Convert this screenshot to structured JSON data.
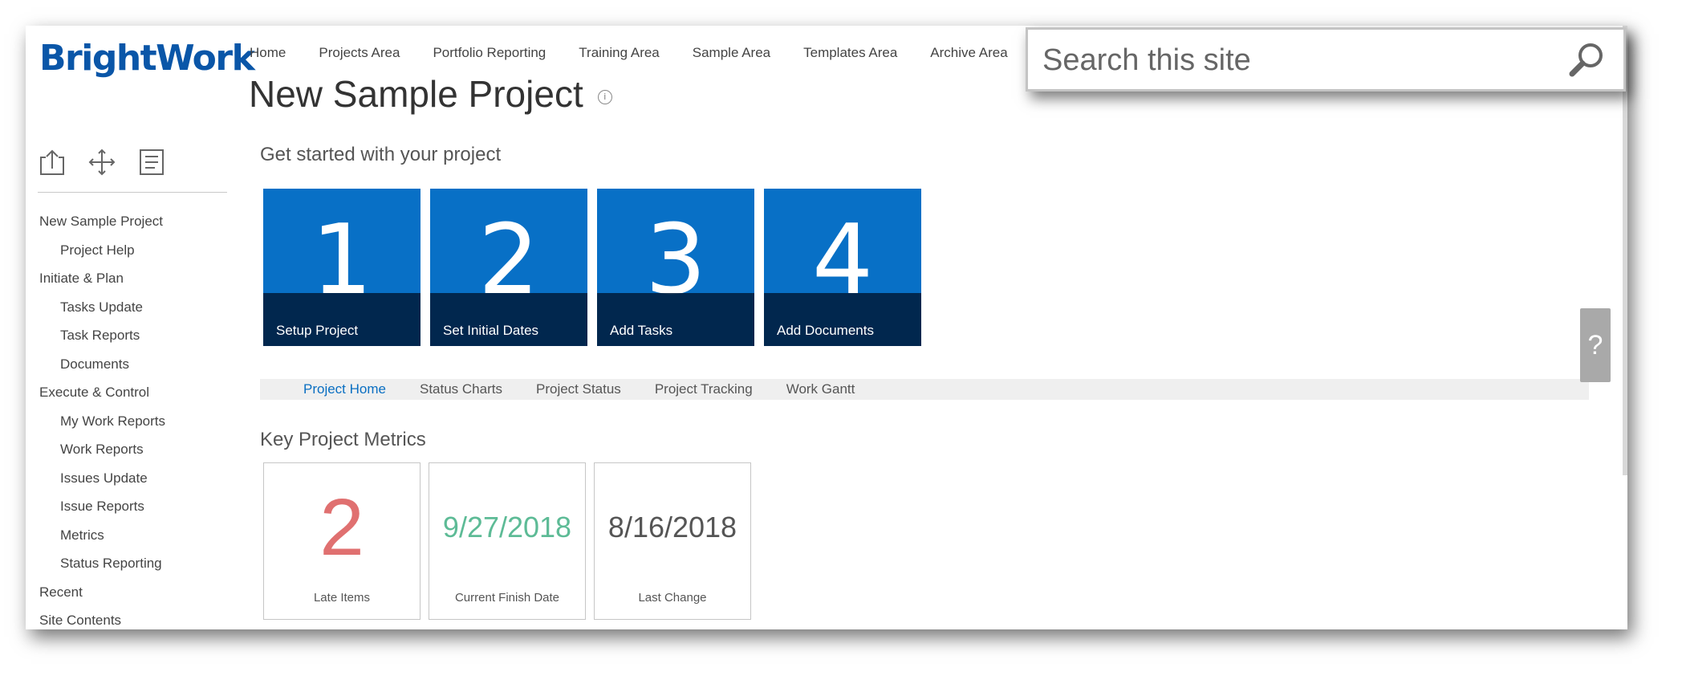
{
  "brand": {
    "logo_text": "BrightWork",
    "color": "#0a56a8"
  },
  "top_nav": [
    "Home",
    "Projects Area",
    "Portfolio Reporting",
    "Training Area",
    "Sample Area",
    "Templates Area",
    "Archive Area"
  ],
  "search": {
    "placeholder": "Search this site",
    "icon": "search-icon"
  },
  "page": {
    "title": "New Sample Project",
    "info_icon": "info-icon"
  },
  "toolbar_icons": [
    "upload-icon",
    "move-icon",
    "list-icon"
  ],
  "side_nav": [
    {
      "label": "New Sample Project",
      "level": 0
    },
    {
      "label": "Project Help",
      "level": 1
    },
    {
      "label": "Initiate & Plan",
      "level": 0
    },
    {
      "label": "Tasks Update",
      "level": 1
    },
    {
      "label": "Task Reports",
      "level": 1
    },
    {
      "label": "Documents",
      "level": 1
    },
    {
      "label": "Execute & Control",
      "level": 0
    },
    {
      "label": "My Work Reports",
      "level": 1
    },
    {
      "label": "Work Reports",
      "level": 1
    },
    {
      "label": "Issues Update",
      "level": 1
    },
    {
      "label": "Issue Reports",
      "level": 1
    },
    {
      "label": "Metrics",
      "level": 1
    },
    {
      "label": "Status Reporting",
      "level": 1
    },
    {
      "label": "Recent",
      "level": 0
    },
    {
      "label": "Site Contents",
      "level": 0
    }
  ],
  "get_started": {
    "heading": "Get started with your project",
    "tiles": [
      {
        "number": "1",
        "label": "Setup Project"
      },
      {
        "number": "2",
        "label": "Set Initial Dates"
      },
      {
        "number": "3",
        "label": "Add Tasks"
      },
      {
        "number": "4",
        "label": "Add Documents"
      }
    ],
    "tile_color": "#0870c6"
  },
  "tabs": {
    "items": [
      "Project Home",
      "Status Charts",
      "Project Status",
      "Project Tracking",
      "Work Gantt"
    ],
    "active": "Project Home",
    "active_color": "#0a6fc2"
  },
  "metrics": {
    "heading": "Key Project Metrics",
    "items": [
      {
        "value": "2",
        "caption": "Late Items",
        "color": "#e07070",
        "font_size": 100
      },
      {
        "value": "9/27/2018",
        "caption": "Current Finish Date",
        "color": "#5dbb96",
        "font_size": 36
      },
      {
        "value": "8/16/2018",
        "caption": "Last Change",
        "color": "#555555",
        "font_size": 36
      }
    ]
  },
  "help_button": {
    "label": "?"
  }
}
